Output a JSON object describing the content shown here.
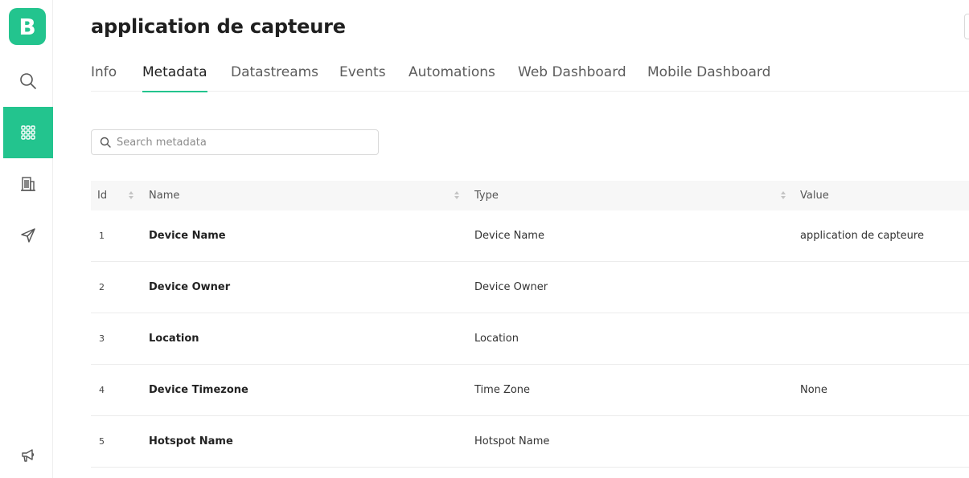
{
  "app": {
    "logo_letter": "B",
    "accent_color": "#23c48e"
  },
  "sidebar": {
    "items": [
      {
        "icon": "search-icon",
        "active": false
      },
      {
        "icon": "grid-icon",
        "active": true
      },
      {
        "icon": "building-icon",
        "active": false
      },
      {
        "icon": "send-icon",
        "active": false
      },
      {
        "icon": "megaphone-icon",
        "active": false
      }
    ]
  },
  "page": {
    "title": "application de capteure"
  },
  "tabs": [
    {
      "label": "Info",
      "active": false
    },
    {
      "label": "Metadata",
      "active": true
    },
    {
      "label": "Datastreams",
      "active": false
    },
    {
      "label": "Events",
      "active": false
    },
    {
      "label": "Automations",
      "active": false
    },
    {
      "label": "Web Dashboard",
      "active": false
    },
    {
      "label": "Mobile Dashboard",
      "active": false
    }
  ],
  "search": {
    "placeholder": "Search metadata",
    "value": ""
  },
  "table": {
    "columns": [
      "Id",
      "Name",
      "Type",
      "Value"
    ],
    "rows": [
      {
        "id": "1",
        "name": "Device Name",
        "type": "Device Name",
        "value": "application de capteure"
      },
      {
        "id": "2",
        "name": "Device Owner",
        "type": "Device Owner",
        "value": ""
      },
      {
        "id": "3",
        "name": "Location",
        "type": "Location",
        "value": ""
      },
      {
        "id": "4",
        "name": "Device Timezone",
        "type": "Time Zone",
        "value": "None"
      },
      {
        "id": "5",
        "name": "Hotspot Name",
        "type": "Hotspot Name",
        "value": ""
      }
    ]
  }
}
